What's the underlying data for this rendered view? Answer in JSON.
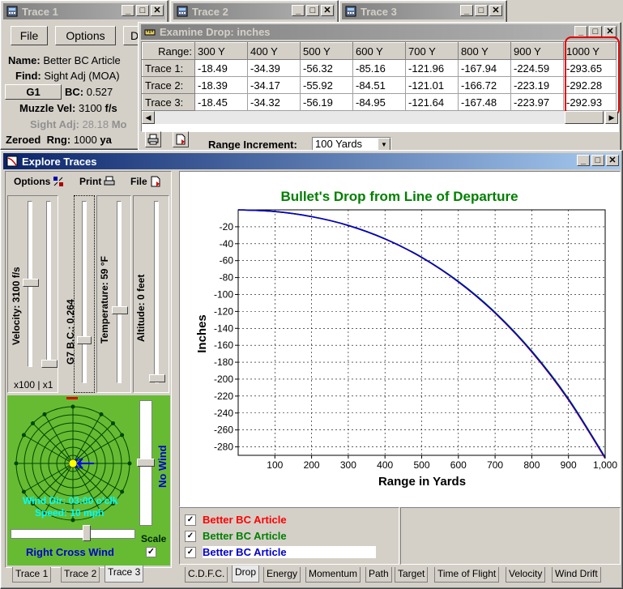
{
  "trace_windows": [
    {
      "title": "Trace 1"
    },
    {
      "title": "Trace 2"
    },
    {
      "title": "Trace 3"
    }
  ],
  "trace1": {
    "file_btn": "File",
    "options_btn": "Options",
    "d_btn": "D",
    "name_label": "Name:",
    "name_value": "Better BC Article",
    "find_label": "Find:",
    "find_value": "Sight Adj (MOA)",
    "g1_btn": "G1",
    "bc_label": "BC:",
    "bc_value": "0.527",
    "muzzle_label": "Muzzle Vel:",
    "muzzle_value": "3100",
    "muzzle_unit": "f/s",
    "sight_label": "Sight Adj:",
    "sight_value": "28.18",
    "sight_unit": "Mo",
    "zeroed_label": "Zeroed",
    "rng_label": "Rng:",
    "rng_value": "1000",
    "rng_unit": "ya"
  },
  "examine": {
    "title": "Examine Drop:  inches",
    "headers": [
      "Range:",
      "300 Y",
      "400 Y",
      "500 Y",
      "600 Y",
      "700 Y",
      "800 Y",
      "900 Y",
      "1000 Y"
    ],
    "rows": [
      {
        "label": "Trace 1:",
        "values": [
          "-18.49",
          "-34.39",
          "-56.32",
          "-85.16",
          "-121.96",
          "-167.94",
          "-224.59",
          "-293.65"
        ]
      },
      {
        "label": "Trace 2:",
        "values": [
          "-18.39",
          "-34.17",
          "-55.92",
          "-84.51",
          "-121.01",
          "-166.72",
          "-223.19",
          "-292.28"
        ]
      },
      {
        "label": "Trace 3:",
        "values": [
          "-18.45",
          "-34.32",
          "-56.19",
          "-84.95",
          "-121.64",
          "-167.48",
          "-223.97",
          "-292.93"
        ]
      }
    ],
    "range_increment_label": "Range Increment:",
    "range_increment_value": "100 Yards"
  },
  "explore": {
    "title": "Explore Traces",
    "options_label": "Options",
    "print_label": "Print",
    "file_label": "File",
    "velocity_label": "Velocity: 3100 f/s",
    "bc_label": "G7 B.C.: 0.264",
    "temp_label": "Temperature: 59 °F",
    "alt_label": "Altitude: 0 feet",
    "scale_label": "x100 | x1",
    "wind_dir": "Wind Dir: 03:00 o'clk",
    "wind_speed": "Speed: 10 mph",
    "no_wind": "No Wind",
    "scale": "Scale",
    "cross_wind": "Right Cross Wind",
    "left_tabs": [
      "Trace 1",
      "Trace 2",
      "Trace 3"
    ],
    "legend": [
      {
        "label": "Better BC Article",
        "color": "#ff0000"
      },
      {
        "label": "Better BC Article",
        "color": "#008000"
      },
      {
        "label": "Better BC Article",
        "color": "#0000cc"
      }
    ],
    "bottom_tabs": [
      "C.D.F.C.",
      "Drop",
      "Energy",
      "Momentum",
      "Path",
      "Target",
      "Time of Flight",
      "Velocity",
      "Wind Drift"
    ]
  },
  "chart_data": {
    "type": "line",
    "title": "Bullet's Drop from Line of Departure",
    "xlabel": "Range in Yards",
    "ylabel": "Inches",
    "xlim": [
      0,
      1000
    ],
    "ylim": [
      -290,
      0
    ],
    "xticks": [
      100,
      200,
      300,
      400,
      500,
      600,
      700,
      800,
      900,
      1000
    ],
    "xtick_labels": [
      "100",
      "200",
      "300",
      "400",
      "500",
      "600",
      "700",
      "800",
      "900",
      "1,000"
    ],
    "yticks": [
      -20,
      -40,
      -60,
      -80,
      -100,
      -120,
      -140,
      -160,
      -180,
      -200,
      -220,
      -240,
      -260,
      -280
    ],
    "title_color": "#008000",
    "series": [
      {
        "color": "#ff0000",
        "x": [
          0,
          100,
          200,
          300,
          400,
          500,
          600,
          700,
          800,
          900,
          1000
        ],
        "y": [
          0,
          -2.0,
          -8.0,
          -18.49,
          -34.39,
          -56.32,
          -85.16,
          -121.96,
          -167.94,
          -224.59,
          -293.65
        ]
      },
      {
        "color": "#008000",
        "x": [
          0,
          100,
          200,
          300,
          400,
          500,
          600,
          700,
          800,
          900,
          1000
        ],
        "y": [
          0,
          -2.0,
          -8.0,
          -18.39,
          -34.17,
          -55.92,
          -84.51,
          -121.01,
          -166.72,
          -223.19,
          -292.28
        ]
      },
      {
        "color": "#0000cc",
        "x": [
          0,
          100,
          200,
          300,
          400,
          500,
          600,
          700,
          800,
          900,
          1000
        ],
        "y": [
          0,
          -2.0,
          -8.0,
          -18.45,
          -34.32,
          -56.19,
          -84.95,
          -121.64,
          -167.48,
          -223.97,
          -292.93
        ]
      }
    ]
  }
}
